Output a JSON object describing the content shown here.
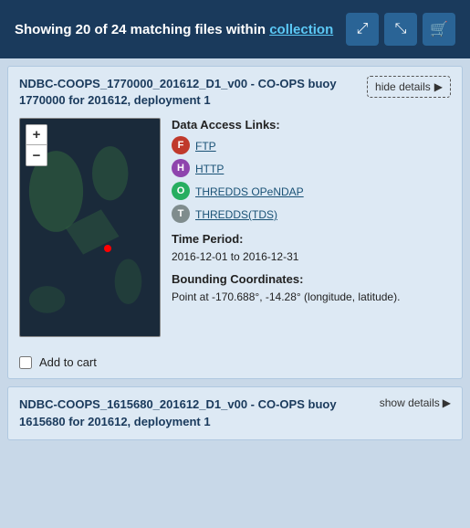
{
  "header": {
    "summary": "Showing 20 of 24 matching files within",
    "collection_link_text": "collection",
    "btn_expand_label": "expand",
    "btn_collapse_label": "collapse",
    "btn_cart_label": "cart"
  },
  "cards": [
    {
      "id": "card-1",
      "title": "NDBC-COOPS_1770000_201612_D1_v00 - CO-OPS buoy 1770000 for 201612, deployment 1",
      "details_toggle_label": "hide details",
      "expanded": true,
      "data_access_title": "Data Access Links:",
      "links": [
        {
          "badge": "F",
          "badge_class": "badge-f",
          "label": "FTP",
          "url": "#"
        },
        {
          "badge": "H",
          "badge_class": "badge-h",
          "label": "HTTP",
          "url": "#"
        },
        {
          "badge": "O",
          "badge_class": "badge-o",
          "label": "THREDDS OPeNDAP",
          "url": "#"
        },
        {
          "badge": "T",
          "badge_class": "badge-t",
          "label": "THREDDS(TDS)",
          "url": "#"
        }
      ],
      "time_period_title": "Time Period:",
      "time_period_value": "2016-12-01 to 2016-12-31",
      "bounding_title": "Bounding Coordinates:",
      "bounding_value": "Point at -170.688°, -14.28° (longitude, latitude).",
      "cart_label": "Add to cart"
    },
    {
      "id": "card-2",
      "title": "NDBC-COOPS_1615680_201612_D1_v00 - CO-OPS buoy 1615680 for 201612, deployment 1",
      "details_toggle_label": "show details",
      "expanded": false
    }
  ],
  "icons": {
    "expand": "⤢",
    "collapse": "⤡",
    "cart": "🛒",
    "chevron_right": "▶"
  }
}
